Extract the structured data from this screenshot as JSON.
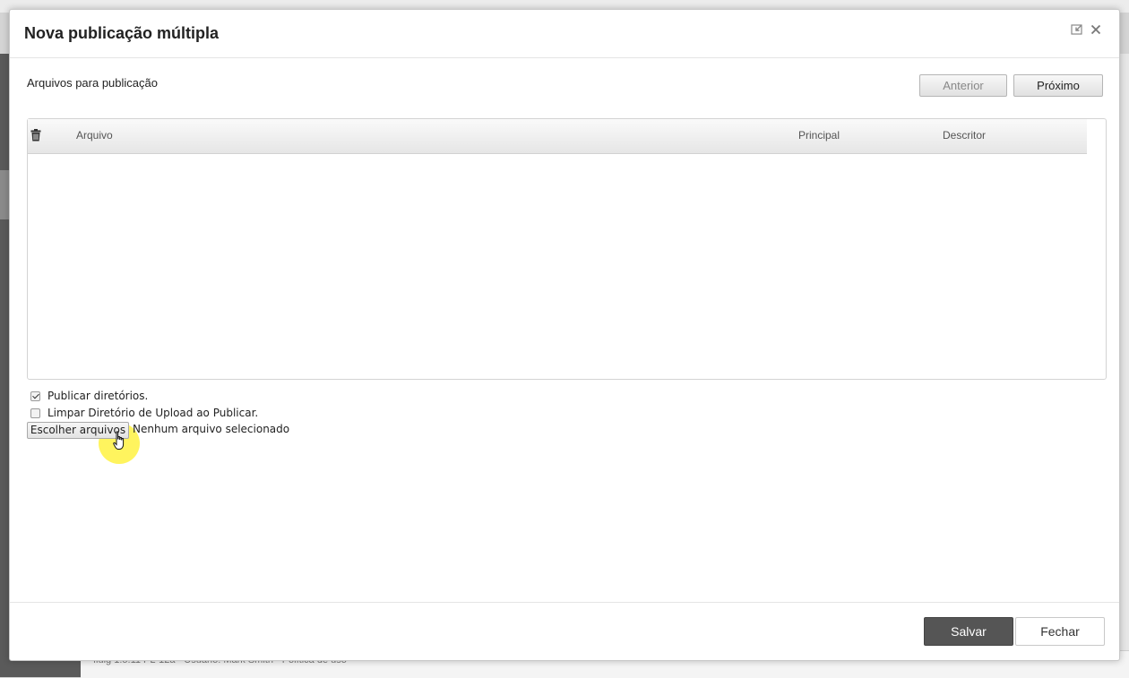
{
  "background": {
    "footer_text": "fluig 1.5.11 PL-12a · Usuário: Mark Smith · Política de uso"
  },
  "modal": {
    "title": "Nova publicação múltipla",
    "header_icons": [
      "restore-window-icon",
      "close-icon"
    ],
    "section_title": "Arquivos para publicação",
    "prev_button": "Anterior",
    "next_button": "Próximo",
    "table": {
      "columns": [
        "Arquivo",
        "Principal",
        "Descritor"
      ],
      "rows": []
    },
    "options": {
      "publish_dirs_label": "Publicar diretórios.",
      "publish_dirs_checked": true,
      "clear_upload_label": "Limpar Diretório de Upload ao Publicar.",
      "clear_upload_checked": false
    },
    "file_input": {
      "button_label": "Escolher arquivos",
      "status": "Nenhum arquivo selecionado"
    },
    "footer": {
      "save_button": "Salvar",
      "close_button": "Fechar"
    }
  },
  "colors": {
    "primary_button": "#555555",
    "modal_bg": "#ffffff",
    "cursor_highlight": "#fff028"
  }
}
